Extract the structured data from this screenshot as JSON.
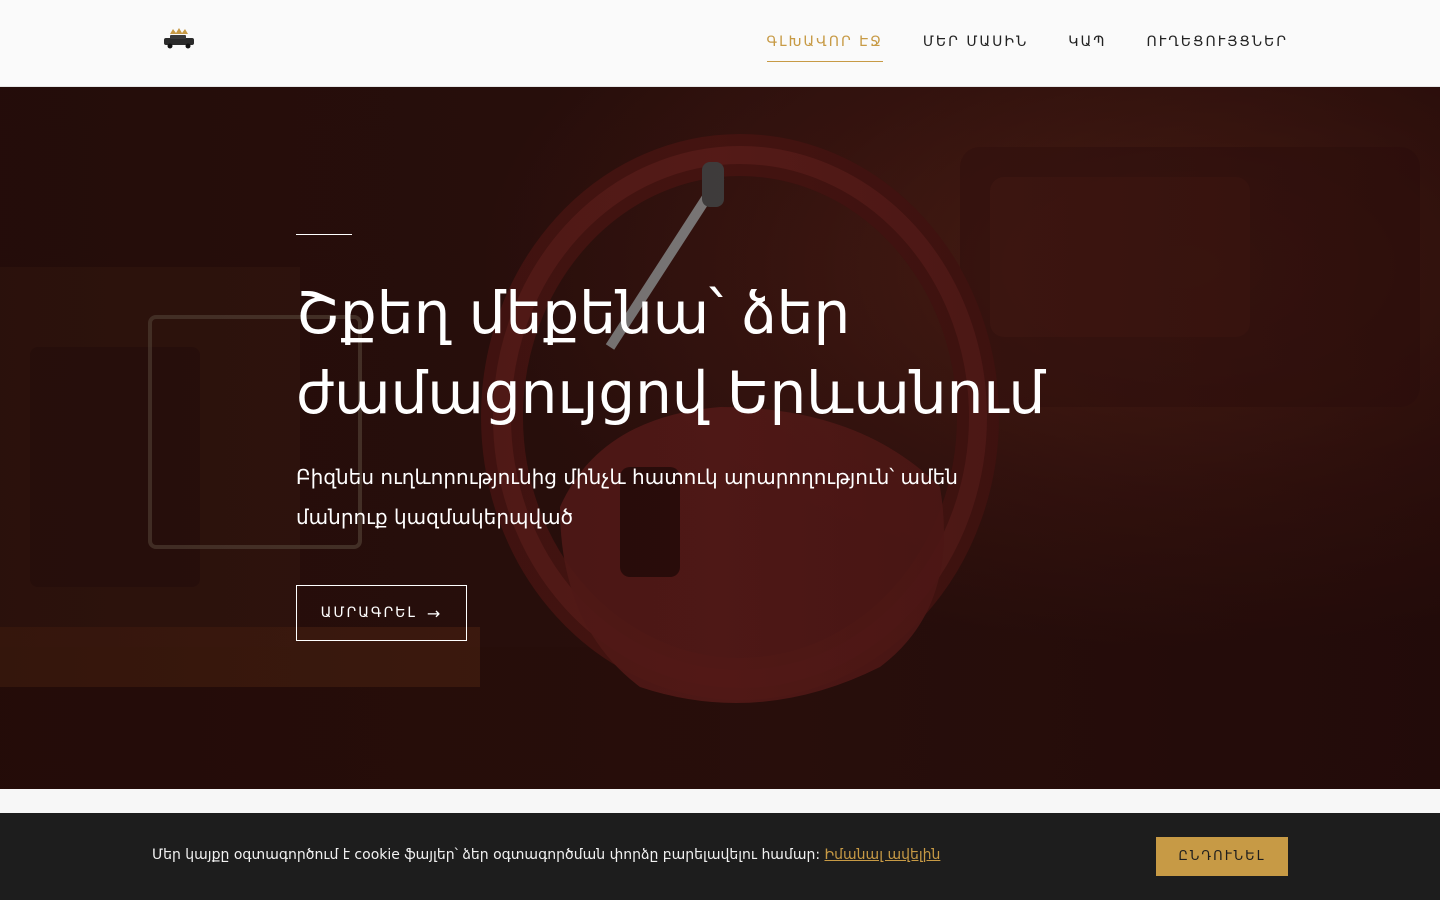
{
  "nav": {
    "items": [
      {
        "label": "ԳԼԽԱՎՈՐ ԷՋ",
        "active": true
      },
      {
        "label": "ՄԵՐ ՄԱՍԻՆ",
        "active": false
      },
      {
        "label": "ԿԱՊ",
        "active": false
      },
      {
        "label": "ՈՒՂԵՑՈՒՅՑՆԵՐ",
        "active": false
      }
    ]
  },
  "hero": {
    "title": "Շքեղ մեքենա՝ ձեր ժամացույցով Երևանում",
    "subtitle": "Բիզնես ուղևորությունից մինչև հատուկ արարողություն՝ ամեն մանրուք կազմակերպված",
    "button_label": "ԱՄՐԱԳՐԵԼ"
  },
  "cookie": {
    "text": "Մեր կայքը օգտագործում է cookie ֆայլեր՝ ձեր օգտագործման փորձը բարելավելու համար: ",
    "link_label": "Իմանալ ավելին",
    "button_label": "ԸՆԴՈՒՆԵԼ"
  },
  "colors": {
    "accent": "#c79a45",
    "header_bg": "#fafafa",
    "cookie_bg": "#1d1d1d",
    "hero_text": "#ffffff"
  },
  "icons": {
    "logo": "limousine-crown-logo",
    "button_arrow": "arrow-right-icon"
  }
}
